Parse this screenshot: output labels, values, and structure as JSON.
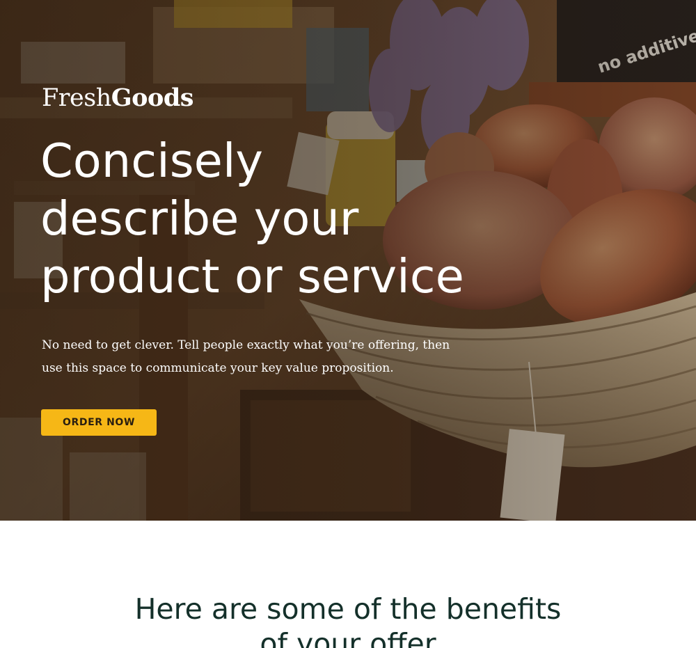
{
  "logo": {
    "light": "Fresh",
    "bold": "Goods"
  },
  "hero": {
    "headline_lines": [
      "Concisely",
      "describe your",
      "product or service"
    ],
    "subtext_lines": [
      "No need to get clever. Tell people exactly what you’re offering, then",
      "use this space to communicate your key value proposition."
    ],
    "cta_label": "ORDER NOW",
    "sign_text": "no additives"
  },
  "benefits": {
    "title_lines": [
      "Here are some of the benefits",
      "of your offer"
    ]
  },
  "colors": {
    "accent": "#f6b716",
    "title_dark": "#14302a",
    "hero_overlay": "#2a1a0c"
  }
}
